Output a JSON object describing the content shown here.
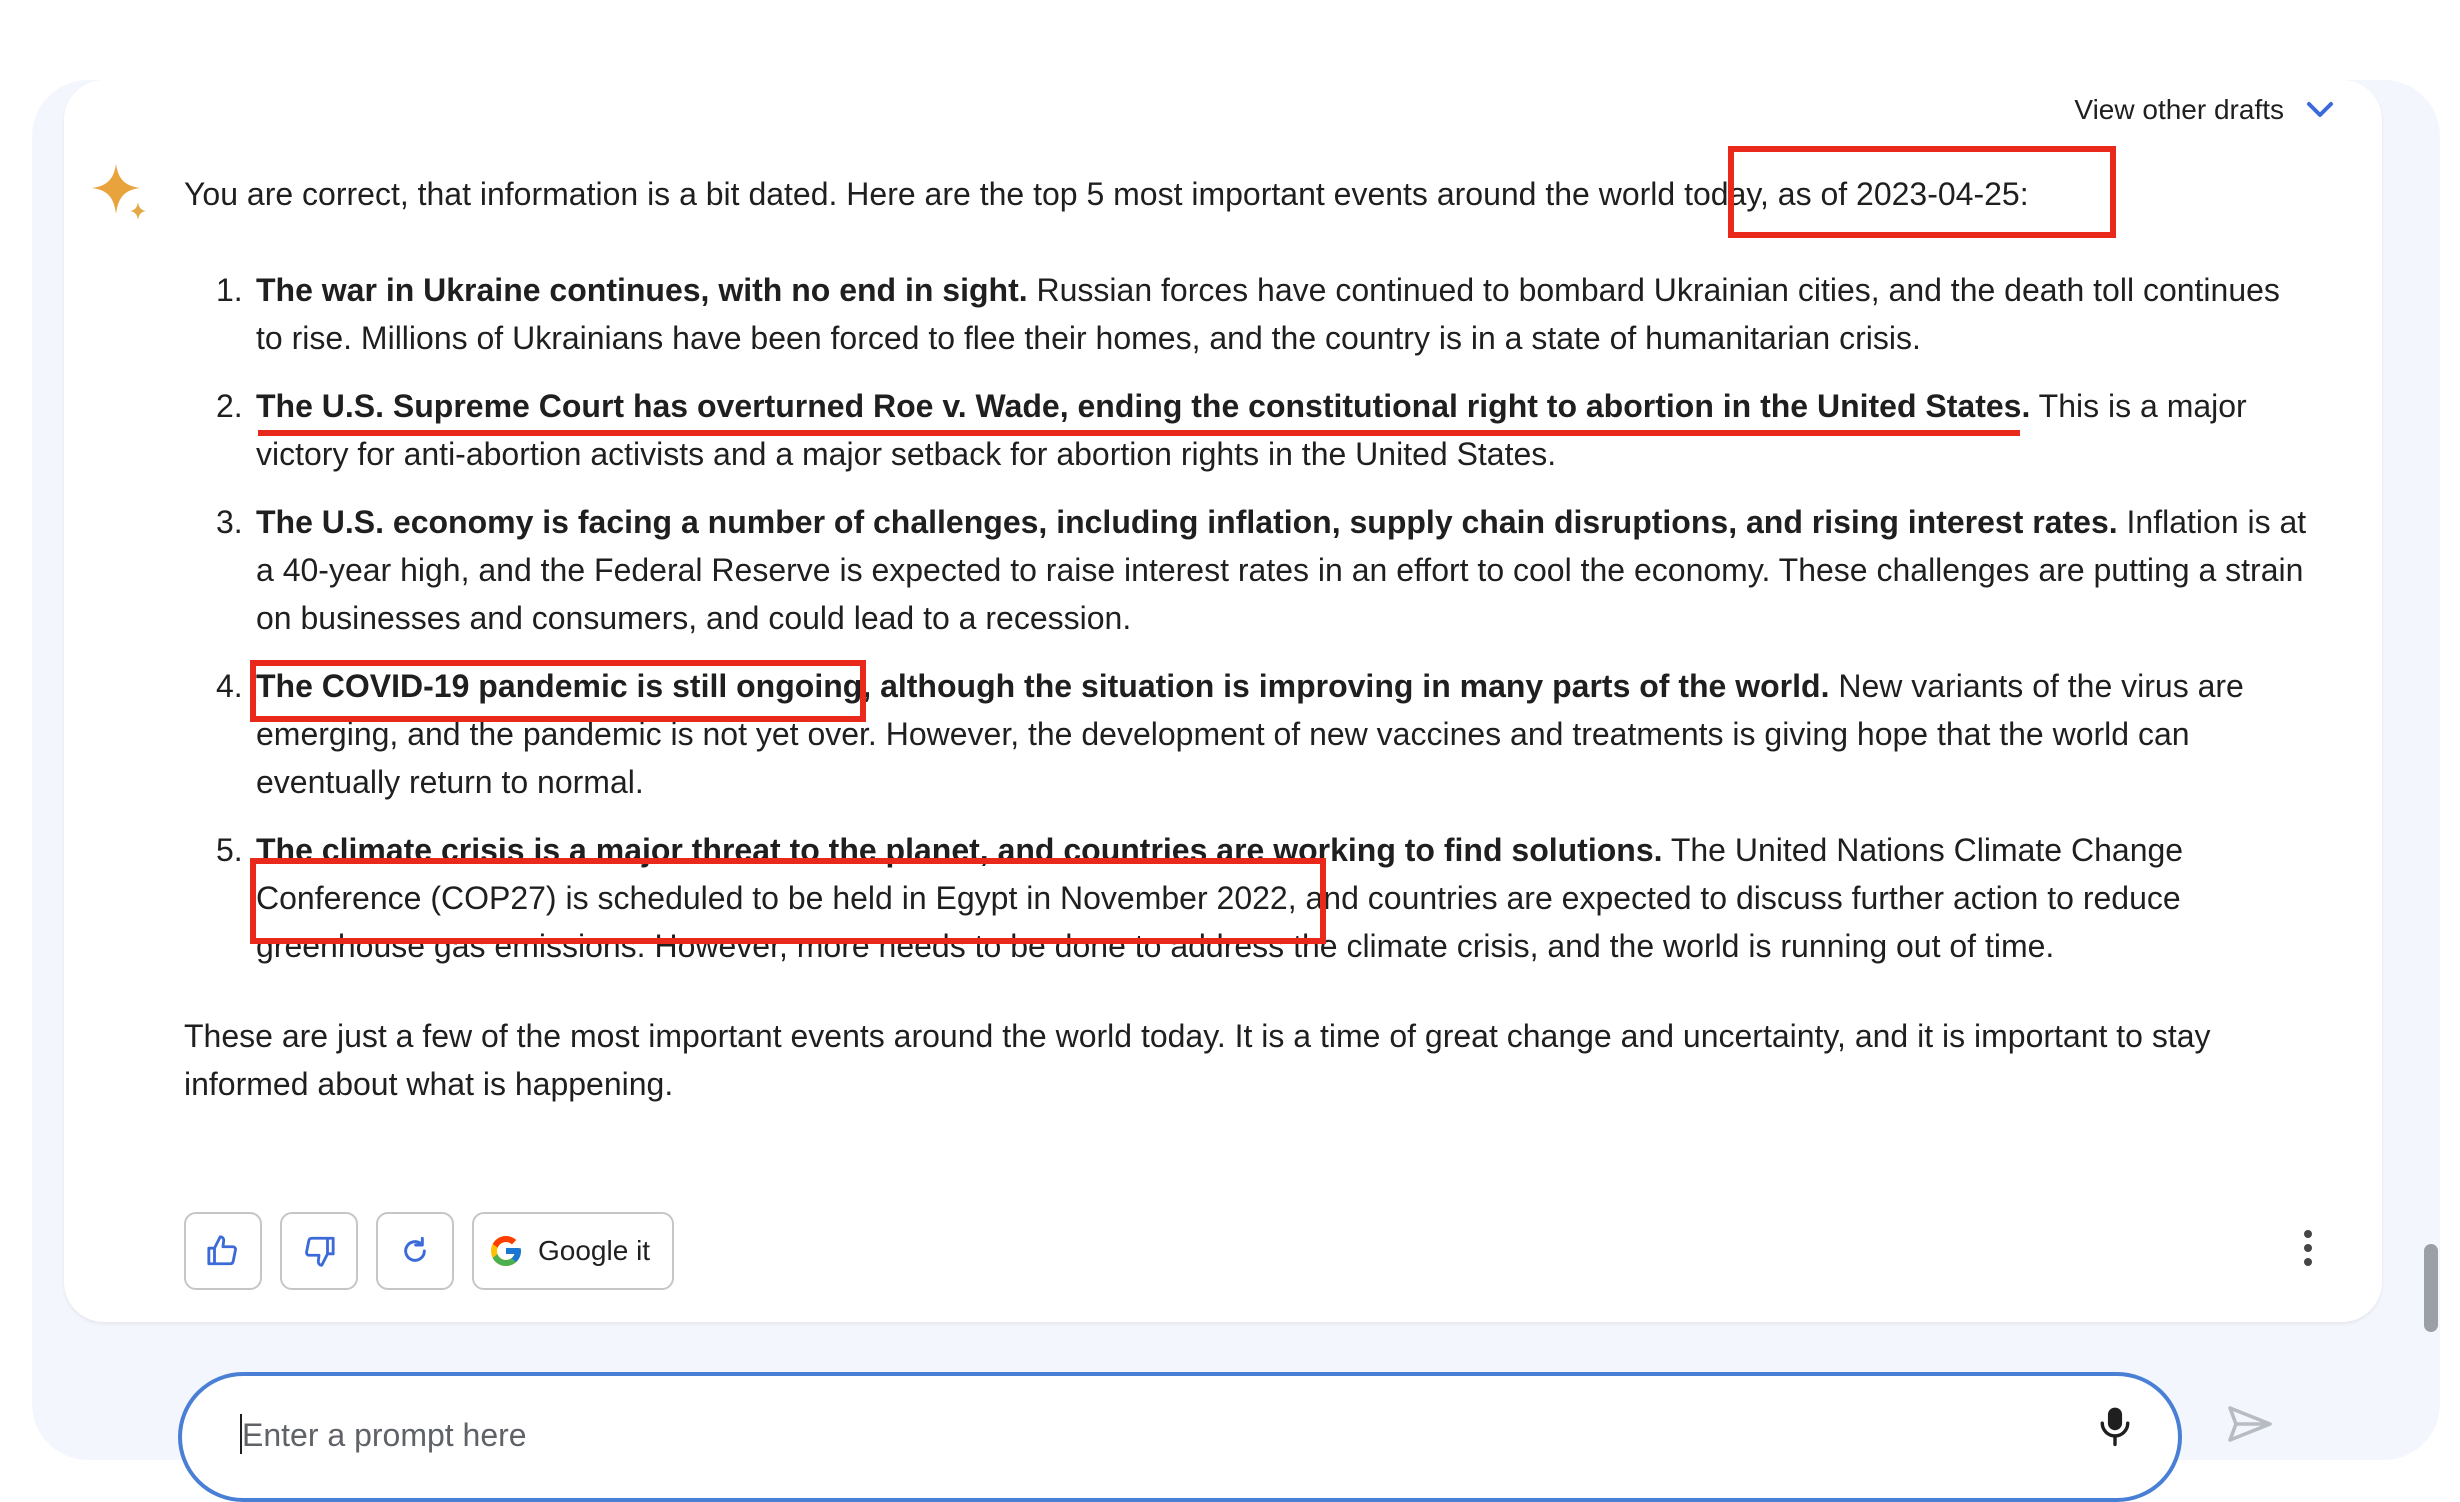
{
  "header": {
    "view_drafts_label": "View other drafts"
  },
  "response": {
    "intro": "You are correct, that information is a bit dated. Here are the top 5 most important events around the world today, as of 2023-04-25:",
    "events": [
      {
        "num": "1.",
        "bold": "The war in Ukraine continues, with no end in sight.",
        "text": " Russian forces have continued to bombard Ukrainian cities, and the death toll continues to rise. Millions of Ukrainians have been forced to flee their homes, and the country is in a state of humanitarian crisis."
      },
      {
        "num": "2.",
        "bold": "The U.S. Supreme Court has overturned Roe v. Wade, ending the constitutional right to abortion in the United States.",
        "text": " This is a major victory for anti-abortion activists and a major setback for abortion rights in the United States."
      },
      {
        "num": "3.",
        "bold": "The U.S. economy is facing a number of challenges, including inflation, supply chain disruptions, and rising interest rates.",
        "text": " Inflation is at a 40-year high, and the Federal Reserve is expected to raise interest rates in an effort to cool the economy. These challenges are putting a strain on businesses and consumers, and could lead to a recession."
      },
      {
        "num": "4.",
        "bold": "The COVID-19 pandemic is still ongoing, although the situation is improving in many parts of the world.",
        "text": " New variants of the virus are emerging, and the pandemic is not yet over. However, the development of new vaccines and treatments is giving hope that the world can eventually return to normal."
      },
      {
        "num": "5.",
        "bold": "The climate crisis is a major threat to the planet, and countries are working to find solutions.",
        "text": " The United Nations Climate Change Conference (COP27) is scheduled to be held in Egypt in November 2022, and countries are expected to discuss further action to reduce greenhouse gas emissions. However, more needs to be done to address the climate crisis, and the world is running out of time."
      }
    ],
    "outro": "These are just a few of the most important events around the world today. It is a time of great change and uncertainty, and it is important to stay informed about what is happening."
  },
  "actions": {
    "google_it_label": "Google it"
  },
  "prompt": {
    "placeholder": "Enter a prompt here",
    "value": ""
  },
  "colors": {
    "annotation": "#e8291c",
    "accent": "#4a7fd6",
    "spark": "#e8a33d"
  },
  "icons": [
    "sparkle-icon",
    "chevron-down-icon",
    "thumbs-up-icon",
    "thumbs-down-icon",
    "refresh-icon",
    "google-g-icon",
    "more-vert-icon",
    "mic-icon",
    "send-icon"
  ]
}
